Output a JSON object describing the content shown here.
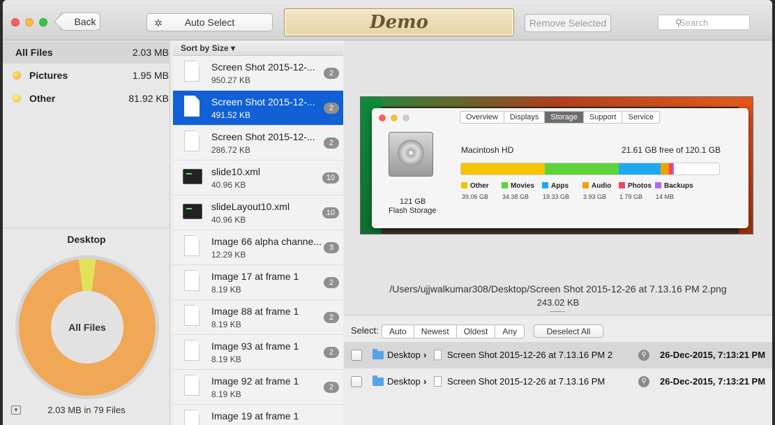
{
  "toolbar": {
    "back_label": "Back",
    "auto_select_label": "Auto Select",
    "app_title": "Demo",
    "remove_selected_label": "Remove Selected",
    "search_placeholder": "Search"
  },
  "sidebar": {
    "categories": [
      {
        "name": "All Files",
        "size": "2.03 MB"
      },
      {
        "name": "Pictures",
        "size": "1.95 MB"
      },
      {
        "name": "Other",
        "size": "81.92 KB"
      }
    ],
    "desktop_title": "Desktop",
    "donut_center": "All Files",
    "donut_share": {
      "Pictures": 0.96,
      "Other": 0.04
    },
    "footer": "2.03 MB in 79 Files"
  },
  "filelist": {
    "sort_label": "Sort by Size ▾",
    "files": [
      {
        "name": "Screen Shot 2015-12-...",
        "size": "950.27 KB",
        "count": "2",
        "icon": "document-icon"
      },
      {
        "name": "Screen Shot 2015-12-...",
        "size": "491.52 KB",
        "count": "2",
        "icon": "document-icon"
      },
      {
        "name": "Screen Shot 2015-12-...",
        "size": "286.72 KB",
        "count": "2",
        "icon": "document-icon"
      },
      {
        "name": "slide10.xml",
        "size": "40.96 KB",
        "count": "10",
        "icon": "terminal-icon"
      },
      {
        "name": "slideLayout10.xml",
        "size": "40.96 KB",
        "count": "10",
        "icon": "terminal-icon"
      },
      {
        "name": "Image 66 alpha channe...",
        "size": "12.29 KB",
        "count": "3",
        "icon": "document-icon"
      },
      {
        "name": "Image 17 at frame 1",
        "size": "8.19 KB",
        "count": "2",
        "icon": "document-icon"
      },
      {
        "name": "Image 88 at frame 1",
        "size": "8.19 KB",
        "count": "2",
        "icon": "document-icon"
      },
      {
        "name": "Image 93 at frame 1",
        "size": "8.19 KB",
        "count": "2",
        "icon": "document-icon"
      },
      {
        "name": "Image 92 at frame 1",
        "size": "8.19 KB",
        "count": "2",
        "icon": "document-icon"
      },
      {
        "name": "Image 19 at frame 1",
        "size": "",
        "count": "",
        "icon": "document-icon"
      }
    ]
  },
  "preview": {
    "about": {
      "tabs": [
        "Overview",
        "Displays",
        "Storage",
        "Support",
        "Service"
      ],
      "active_tab": "Storage",
      "disk_name": "Macintosh HD",
      "free_text": "21.61 GB free of 120.1 GB",
      "capacity": "121 GB",
      "storage_type": "Flash Storage",
      "segments": [
        {
          "name": "Other",
          "size": "39.06 GB",
          "color": "#f5c400"
        },
        {
          "name": "Movies",
          "size": "34.38 GB",
          "color": "#5ed33c"
        },
        {
          "name": "Apps",
          "size": "19.33 GB",
          "color": "#1eaaf0"
        },
        {
          "name": "Audio",
          "size": "3.93 GB",
          "color": "#f0a000"
        },
        {
          "name": "Photos",
          "size": "1.79 GB",
          "color": "#f0455c"
        },
        {
          "name": "Backups",
          "size": "14 MB",
          "color": "#b06cf0"
        }
      ]
    },
    "path": "/Users/ujjwalkumar308/Desktop/Screen Shot 2015-12-26 at 7.13.16 PM 2.png",
    "size": "243.02 KB"
  },
  "select_bar": {
    "label": "Select:",
    "options": [
      "Auto",
      "Newest",
      "Oldest",
      "Any"
    ],
    "deselect_label": "Deselect All"
  },
  "duplicates": [
    {
      "folder": "Desktop",
      "file": "Screen Shot 2015-12-26 at 7.13.16 PM 2",
      "date": "26-Dec-2015, 7:13:21 PM"
    },
    {
      "folder": "Desktop",
      "file": "Screen Shot 2015-12-26 at 7.13.16 PM",
      "date": "26-Dec-2015, 7:13:21 PM"
    }
  ]
}
